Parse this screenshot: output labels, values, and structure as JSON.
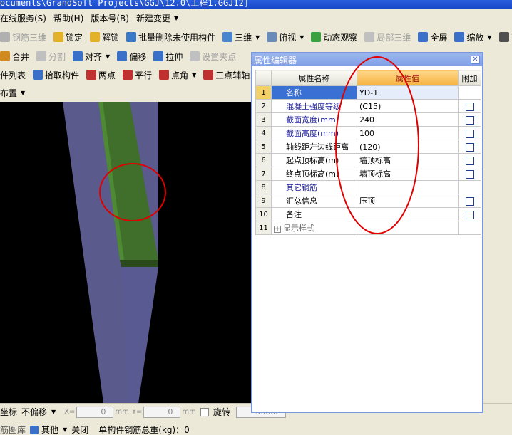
{
  "window": {
    "title": "ocuments\\GrandSoft Projects\\GGJ\\12.0\\工程1.GGJ12]"
  },
  "menu": {
    "items": [
      {
        "label": "在线服务(S)",
        "caret": false
      },
      {
        "label": "帮助(H)",
        "caret": false
      },
      {
        "label": "版本号(B)",
        "caret": false
      },
      {
        "label": "新建变更",
        "caret": true
      }
    ]
  },
  "toolbar1": {
    "items": [
      {
        "name": "rebar-3d-button",
        "label": "钢筋三维",
        "disabled": true,
        "icon": "rebar-icon",
        "color": "#b0b0b0",
        "caret": false
      },
      {
        "name": "lock-button",
        "label": "锁定",
        "disabled": false,
        "icon": "lock-icon",
        "color": "#e3b12a",
        "caret": false
      },
      {
        "name": "unlock-button",
        "label": "解锁",
        "disabled": false,
        "icon": "unlock-icon",
        "color": "#e3b12a",
        "caret": false
      },
      {
        "name": "batch-delete-unused-button",
        "label": "批量删除未使用构件",
        "disabled": false,
        "icon": "brush-icon",
        "color": "#3a78c8",
        "caret": false
      },
      {
        "name": "3d-view-button",
        "label": "三维",
        "disabled": false,
        "icon": "cube-icon",
        "color": "#4a86d0",
        "caret": true
      },
      {
        "name": "top-view-button",
        "label": "俯视",
        "disabled": false,
        "icon": "box-icon",
        "color": "#6a8ab8",
        "caret": true
      },
      {
        "name": "dynamic-view-button",
        "label": "动态观察",
        "disabled": false,
        "icon": "orbit-icon",
        "color": "#3aa040",
        "caret": false
      },
      {
        "name": "local-3d-button",
        "label": "局部三维",
        "disabled": true,
        "icon": "local-3d-icon",
        "color": "#c0c0c0",
        "caret": false
      },
      {
        "name": "fullscreen-button",
        "label": "全屏",
        "disabled": false,
        "icon": "fullscreen-icon",
        "color": "#3a70c8",
        "caret": false
      },
      {
        "name": "zoom-button",
        "label": "缩放",
        "disabled": false,
        "icon": "zoom-icon",
        "color": "#3a70c8",
        "caret": true
      },
      {
        "name": "pan-button",
        "label": "平",
        "disabled": false,
        "icon": "pan-icon",
        "color": "#505050",
        "caret": false
      }
    ]
  },
  "toolbar2": {
    "items": [
      {
        "name": "merge-button",
        "label": "合并",
        "disabled": false,
        "icon": "merge-icon",
        "color": "#d08a20",
        "caret": false
      },
      {
        "name": "split-button",
        "label": "分割",
        "disabled": true,
        "icon": "split-icon",
        "color": "#c0c0c0",
        "caret": false
      },
      {
        "name": "align-button",
        "label": "对齐",
        "disabled": false,
        "icon": "align-icon",
        "color": "#3a70c8",
        "caret": true
      },
      {
        "name": "offset-button",
        "label": "偏移",
        "disabled": false,
        "icon": "offset-icon",
        "color": "#3a70c8",
        "caret": false
      },
      {
        "name": "stretch-button",
        "label": "拉伸",
        "disabled": false,
        "icon": "stretch-icon",
        "color": "#3a70c8",
        "caret": false
      },
      {
        "name": "set-grip-button",
        "label": "设置夹点",
        "disabled": true,
        "icon": "grip-icon",
        "color": "#c0c0c0",
        "caret": false
      }
    ]
  },
  "toolbar3": {
    "items": [
      {
        "name": "component-list-button",
        "label": "件列表",
        "disabled": false,
        "icon": "",
        "color": "",
        "caret": false
      },
      {
        "name": "pick-component-button",
        "label": "拾取构件",
        "disabled": false,
        "icon": "pick-icon",
        "color": "#3a70c8",
        "caret": false
      },
      {
        "name": "two-point-button",
        "label": "两点",
        "disabled": false,
        "icon": "two-point-icon",
        "color": "#c03030",
        "caret": false
      },
      {
        "name": "parallel-button",
        "label": "平行",
        "disabled": false,
        "icon": "parallel-icon",
        "color": "#c03030",
        "caret": false
      },
      {
        "name": "point-angle-button",
        "label": "点角",
        "disabled": false,
        "icon": "point-angle-icon",
        "color": "#c03030",
        "caret": true
      },
      {
        "name": "three-point-aux-button",
        "label": "三点辅轴",
        "disabled": false,
        "icon": "three-point-icon",
        "color": "#c03030",
        "caret": false
      }
    ]
  },
  "toolbar4": {
    "layout_label": "布置"
  },
  "status_a": {
    "coord_label": "坐标",
    "offset_select": "不偏移",
    "x_label": "X=",
    "x_value": "0",
    "y_label": "Y=",
    "y_value": "0",
    "unit": "mm",
    "rotate_label": "旋转",
    "rotate_value": "0.000"
  },
  "status_b": {
    "left_label": "筋图库",
    "other_label": "其他",
    "close_label": "关闭",
    "weight_label": "单构件钢筋总重(kg)：0"
  },
  "property_editor": {
    "title": "属性编辑器",
    "headers": {
      "name": "属性名称",
      "value": "属性值",
      "extra": "附加"
    },
    "rows": [
      {
        "num": "1",
        "name": "名称",
        "value": "YD-1",
        "checkbox": false,
        "selected": true,
        "style": "link"
      },
      {
        "num": "2",
        "name": "混凝土强度等级",
        "value": "(C15)",
        "checkbox": true,
        "selected": false,
        "style": "link"
      },
      {
        "num": "3",
        "name": "截面宽度(mm)",
        "value": "240",
        "checkbox": true,
        "selected": false,
        "style": "link"
      },
      {
        "num": "4",
        "name": "截面高度(mm)",
        "value": "100",
        "checkbox": true,
        "selected": false,
        "style": "link"
      },
      {
        "num": "5",
        "name": "轴线距左边线距离",
        "value": "(120)",
        "checkbox": true,
        "selected": false,
        "style": "plain"
      },
      {
        "num": "6",
        "name": "起点顶标高(m)",
        "value": "墙顶标高",
        "checkbox": true,
        "selected": false,
        "style": "plain"
      },
      {
        "num": "7",
        "name": "终点顶标高(m)",
        "value": "墙顶标高",
        "checkbox": true,
        "selected": false,
        "style": "plain"
      },
      {
        "num": "8",
        "name": "其它钢筋",
        "value": "",
        "checkbox": false,
        "selected": false,
        "style": "link"
      },
      {
        "num": "9",
        "name": "汇总信息",
        "value": "压顶",
        "checkbox": true,
        "selected": false,
        "style": "plain"
      },
      {
        "num": "10",
        "name": "备注",
        "value": "",
        "checkbox": true,
        "selected": false,
        "style": "plain"
      },
      {
        "num": "11",
        "name": "显示样式",
        "value": "",
        "checkbox": false,
        "selected": false,
        "style": "muted",
        "expander": "+"
      }
    ]
  },
  "colors": {
    "viewport_bg": "#000000",
    "wall": "#6a6aa6",
    "coping": "#3f6f2a",
    "annotation": "#e00000"
  }
}
